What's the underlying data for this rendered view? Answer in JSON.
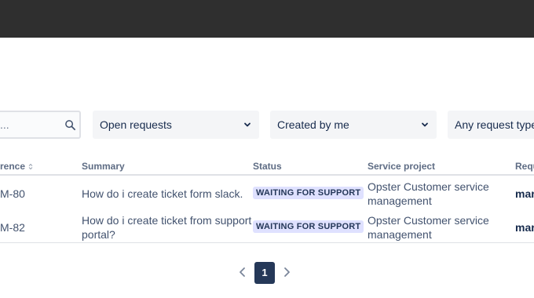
{
  "filters": {
    "search_placeholder": "...",
    "status_filter": "Open requests",
    "creator_filter": "Created by me",
    "type_filter": "Any request type"
  },
  "table": {
    "columns": {
      "reference": "rence",
      "summary": "Summary",
      "status": "Status",
      "service_project": "Service project",
      "requester": "Requ"
    },
    "rows": [
      {
        "reference": "M-80",
        "summary": "How do i create ticket form slack.",
        "status": "WAITING FOR SUPPORT",
        "service_project_line1": "Opster Customer service",
        "service_project_line2": "management",
        "requester": "marc"
      },
      {
        "reference": "M-82",
        "summary_line1": "How do i create ticket from support",
        "summary_line2": "portal?",
        "status": "WAITING FOR SUPPORT",
        "service_project_line1": "Opster Customer service",
        "service_project_line2": "management",
        "requester": "marc"
      }
    ]
  },
  "pagination": {
    "current_page": "1"
  },
  "colors": {
    "topbar": "#2f2f2f",
    "filter_bg": "#f4f5f7",
    "badge_bg": "#dfe1ff",
    "badge_text": "#253858",
    "page_active": "#253858"
  }
}
